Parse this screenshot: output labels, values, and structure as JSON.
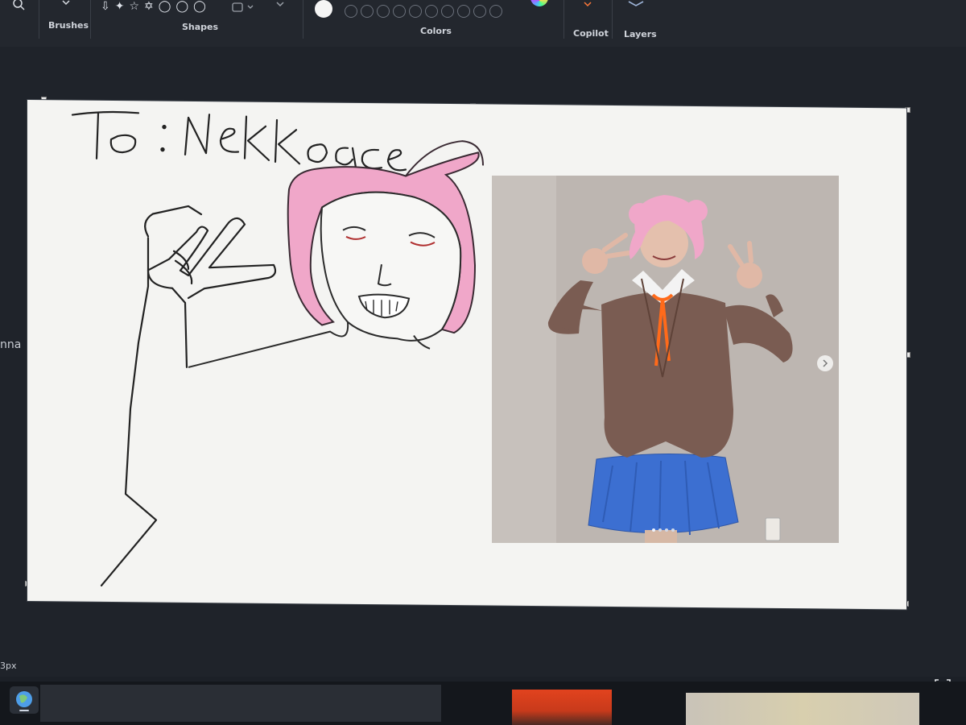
{
  "ribbon": {
    "groups": [
      {
        "id": "brushes",
        "label": "Brushes"
      },
      {
        "id": "shapes",
        "label": "Shapes"
      },
      {
        "id": "colors",
        "label": "Colors"
      },
      {
        "id": "copilot",
        "label": "Copilot"
      },
      {
        "id": "layers",
        "label": "Layers"
      }
    ],
    "shape_glyphs": [
      "⇩",
      "✦",
      "☆",
      "✡",
      "◯",
      "◯",
      "◯"
    ],
    "active_color": "#f5f5f5",
    "palette_slots": 10
  },
  "canvas": {
    "left_edge_text": "nna",
    "drawing_caption": "To : NeKKoace"
  },
  "status": {
    "brush_size": "3px"
  },
  "colors": {
    "ribbon_bg": "#23272e",
    "workspace_bg": "#1f232a",
    "canvas_bg": "#f4f4f2",
    "hair_pink": "#f0a7c9",
    "blazer_brown": "#7a5c52",
    "skirt_blue": "#3c6fd1",
    "ribbon_orange": "#ff6a1a"
  }
}
